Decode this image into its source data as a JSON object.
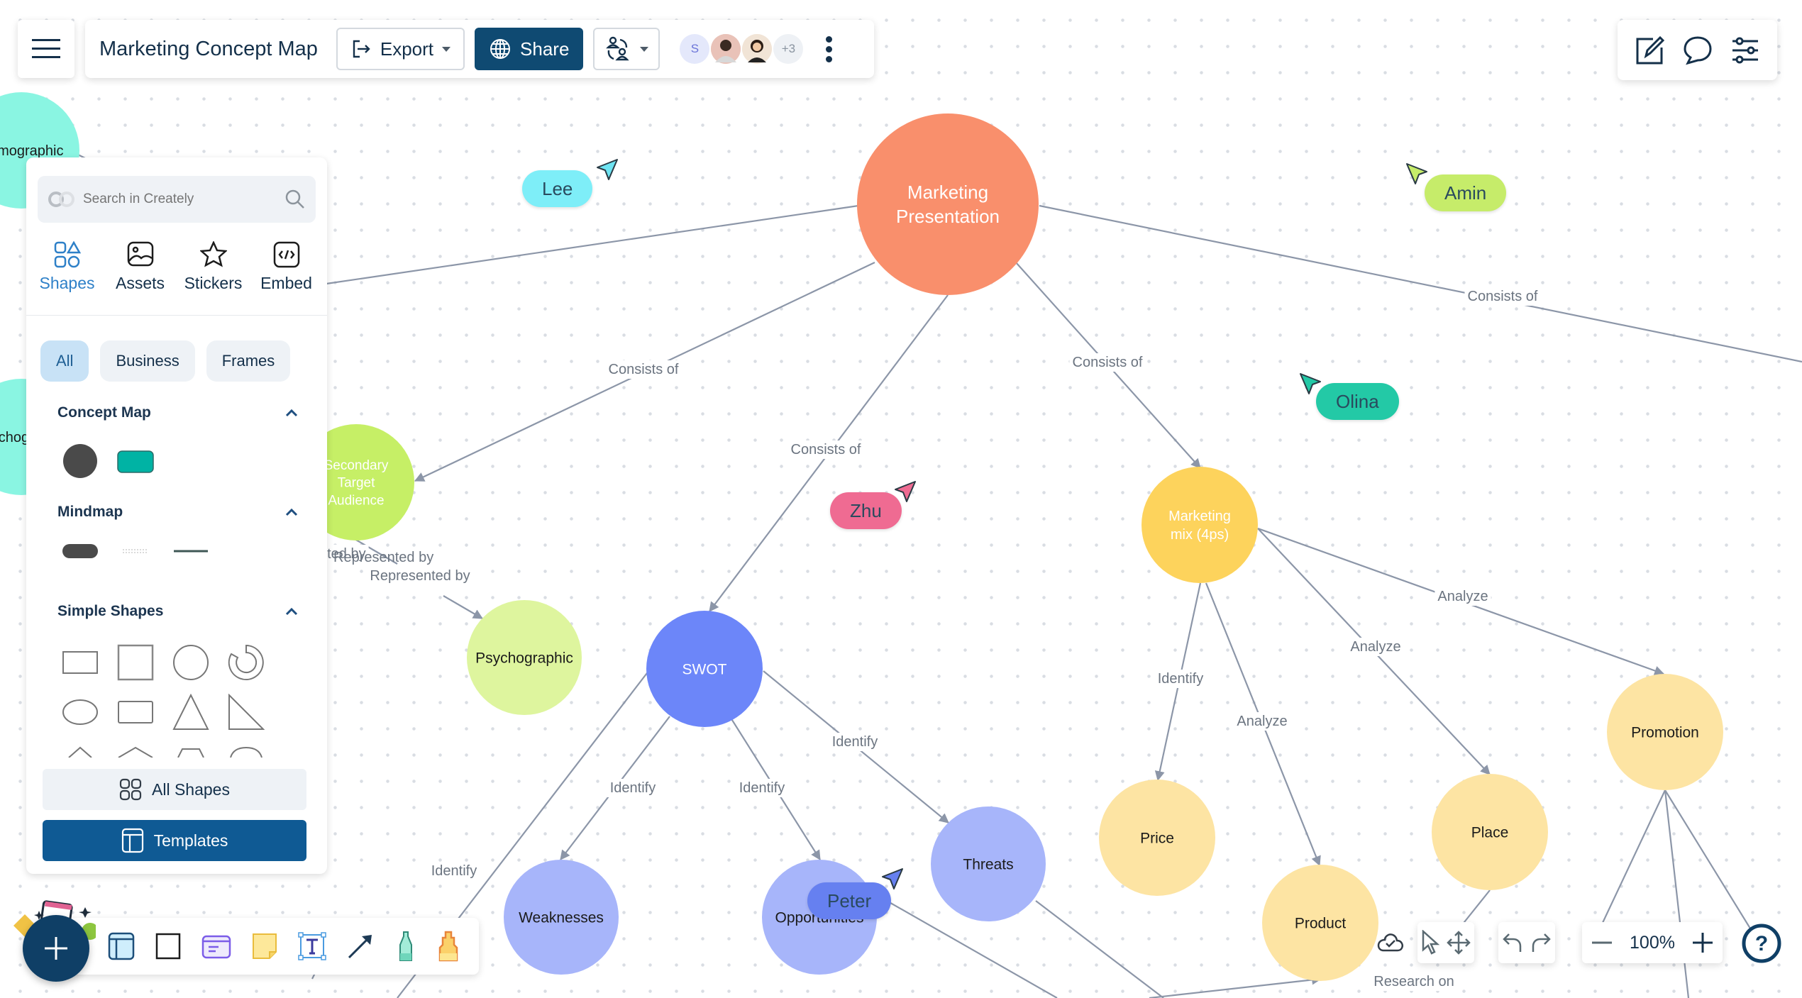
{
  "header": {
    "menu_icon": "hamburger-menu-icon",
    "title": "Marketing Concept Map",
    "export_label": "Export",
    "share_label": "Share",
    "collaborators": [
      {
        "initial": "S",
        "bg": "#e4e8fb",
        "color": "#6b74d8"
      },
      {
        "initial": "",
        "bg": "#e9c2b8",
        "color": "#333"
      },
      {
        "initial": "",
        "bg": "#f1e4d6",
        "color": "#333"
      }
    ],
    "more_collaborators": "+3"
  },
  "right_tools": {
    "icons": [
      "edit-icon",
      "comment-icon",
      "settings-sliders-icon"
    ]
  },
  "panel": {
    "search_placeholder": "Search in Creately",
    "tabs": [
      {
        "label": "Shapes",
        "icon": "shapes-icon",
        "active": true
      },
      {
        "label": "Assets",
        "icon": "image-icon",
        "active": false
      },
      {
        "label": "Stickers",
        "icon": "star-icon",
        "active": false
      },
      {
        "label": "Embed",
        "icon": "code-icon",
        "active": false
      }
    ],
    "chips": [
      {
        "label": "All",
        "active": true
      },
      {
        "label": "Business",
        "active": false
      },
      {
        "label": "Frames",
        "active": false
      }
    ],
    "sections": [
      {
        "title": "Concept Map"
      },
      {
        "title": "Mindmap"
      },
      {
        "title": "Simple Shapes"
      }
    ],
    "all_shapes_label": "All Shapes",
    "templates_label": "Templates"
  },
  "bottom_right": {
    "zoom": "100%"
  },
  "collaborator_cursors": [
    {
      "name": "Lee",
      "bg": "#7eeef8",
      "cursor": "#6ee4f2"
    },
    {
      "name": "Amin",
      "bg": "#c6ec6a",
      "cursor": "#c6ec6a"
    },
    {
      "name": "Olina",
      "bg": "#23c9a6",
      "cursor": "#23c9a6"
    },
    {
      "name": "Zhu",
      "bg": "#ef6b92",
      "cursor": "#ef6b92"
    },
    {
      "name": "Peter",
      "bg": "#6680f0",
      "cursor": "#6680f0"
    }
  ],
  "diagram": {
    "nodes": [
      {
        "id": "root",
        "label": "Marketing\nPresentation",
        "color": "#f98f6c",
        "text": "#ffffff"
      },
      {
        "id": "demographic",
        "label": "Demographic",
        "color": "#8af5e2",
        "text": "#1b1b1b"
      },
      {
        "id": "psycho-left",
        "label": "Psychographic",
        "color": "#8af5e2",
        "text": "#1b1b1b"
      },
      {
        "id": "secondary",
        "label": "Secondary\nTarget\nAudience",
        "color": "#c6ef66",
        "text": "#ffffff"
      },
      {
        "id": "psychographic",
        "label": "Psychographic",
        "color": "#def59e",
        "text": "#1b1b1b"
      },
      {
        "id": "swot",
        "label": "SWOT",
        "color": "#6c86f9",
        "text": "#ffffff"
      },
      {
        "id": "weaknesses",
        "label": "Weaknesses",
        "color": "#a7b5fa",
        "text": "#1b1b1b"
      },
      {
        "id": "opportunities",
        "label": "Opportunities",
        "color": "#a7b5fa",
        "text": "#1b1b1b"
      },
      {
        "id": "threats",
        "label": "Threats",
        "color": "#a7b5fa",
        "text": "#1b1b1b"
      },
      {
        "id": "mix",
        "label": "Marketing\nmix (4ps)",
        "color": "#fdd35c",
        "text": "#ffffff"
      },
      {
        "id": "price",
        "label": "Price",
        "color": "#fde4a3",
        "text": "#1b1b1b"
      },
      {
        "id": "product",
        "label": "Product",
        "color": "#fde4a3",
        "text": "#1b1b1b"
      },
      {
        "id": "place",
        "label": "Place",
        "color": "#fde4a3",
        "text": "#1b1b1b"
      },
      {
        "id": "promotion",
        "label": "Promotion",
        "color": "#fde4a3",
        "text": "#1b1b1b"
      }
    ],
    "edge_labels": [
      "Consists of",
      "Consists of",
      "Consists of",
      "Consists of",
      "Represented by",
      "Represented by",
      "Identify",
      "Identify",
      "Identify",
      "Identify",
      "Analyze",
      "Analyze",
      "Analyze",
      "Analyze",
      "Research on"
    ]
  }
}
